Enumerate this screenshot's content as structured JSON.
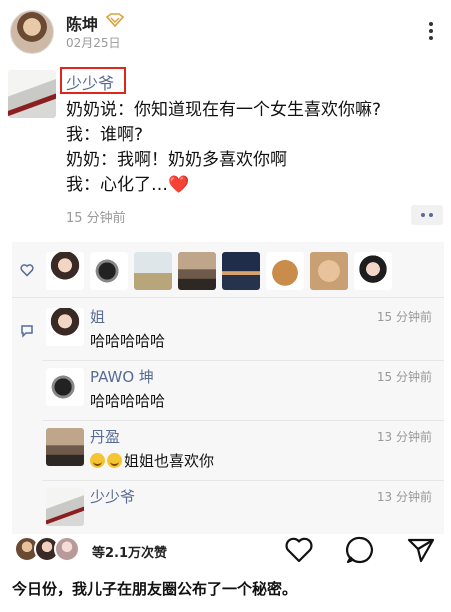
{
  "header": {
    "author": "陈坤",
    "date": "02月25日"
  },
  "moment": {
    "poster_name": "少少爷",
    "lines": [
      "奶奶说：你知道现在有一个女生喜欢你嘛?",
      "我：谁啊?",
      "奶奶：我啊！奶奶多喜欢你啊",
      "我：心化了…"
    ],
    "heart_emoji": "❤️",
    "time": "15 分钟前"
  },
  "comments": [
    {
      "name": "姐",
      "time": "15 分钟前",
      "text": "哈哈哈哈哈"
    },
    {
      "name": "PAWO 坤",
      "time": "15 分钟前",
      "text": "哈哈哈哈哈"
    },
    {
      "name": "丹盈",
      "time": "13 分钟前",
      "text": "姐姐也喜欢你"
    },
    {
      "name": "少少爷",
      "time": "13 分钟前",
      "text": ""
    }
  ],
  "footer": {
    "likes": "等2.1万次赞",
    "caption": "今日份，我儿子在朋友圈公布了一个秘密。"
  },
  "icons": [
    "vip-icon",
    "more-icon",
    "like-icon",
    "comment-icon",
    "heart-icon",
    "chat-icon",
    "share-icon"
  ],
  "colors": {
    "link": "#576b95",
    "highlight_box": "#e0251b",
    "muted": "#999999"
  }
}
